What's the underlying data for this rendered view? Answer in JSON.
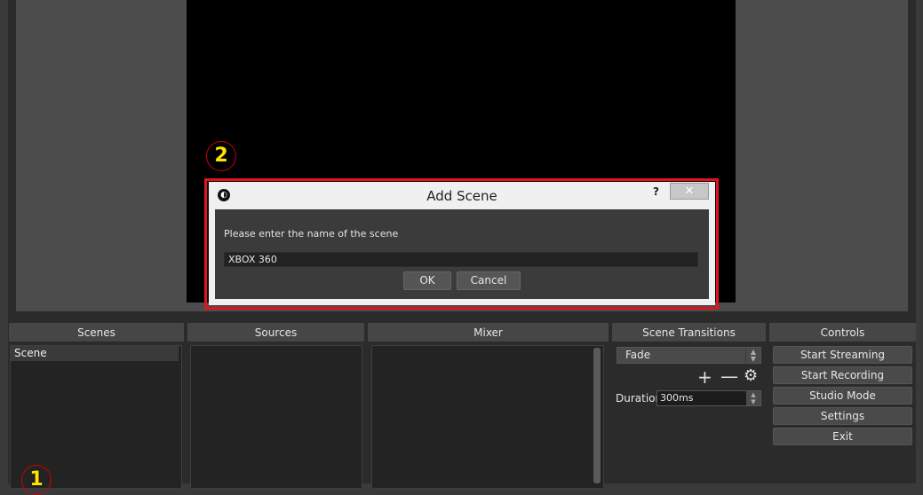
{
  "docks": {
    "scenes": "Scenes",
    "sources": "Sources",
    "mixer": "Mixer",
    "transitions": "Scene Transitions",
    "controls": "Controls"
  },
  "scenes": {
    "items": [
      "Scene"
    ]
  },
  "transitions": {
    "selected": "Fade",
    "duration_label": "Duration",
    "duration_value": "300ms",
    "icons": [
      "plus-icon",
      "minus-icon",
      "gear-icon"
    ]
  },
  "controls": {
    "buttons": [
      "Start Streaming",
      "Start Recording",
      "Studio Mode",
      "Settings",
      "Exit"
    ]
  },
  "annotations": {
    "marker1": "1",
    "marker2": "2"
  },
  "dialog": {
    "title": "Add Scene",
    "help": "?",
    "close": "✕",
    "prompt": "Please enter the name of the scene",
    "input_value": "XBOX 360",
    "ok": "OK",
    "cancel": "Cancel"
  },
  "colors": {
    "highlight": "#e0141e",
    "marker_text": "#ffe400",
    "marker_border": "#cc0000"
  }
}
